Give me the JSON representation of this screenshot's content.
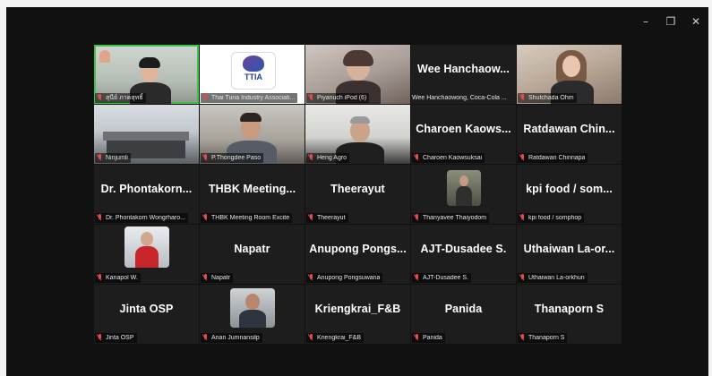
{
  "window": {
    "minimize_icon": "–",
    "restore_icon": "❐",
    "close_icon": "✕"
  },
  "participants": [
    {
      "id": "p0",
      "display_name": "",
      "tag": "สุนีย์ ภาคสุทธิ์",
      "video": true,
      "active": true
    },
    {
      "id": "p1",
      "display_name": "",
      "tag": "Thai Tuna Industry Associati...",
      "video": true,
      "logo_text": "TTIA"
    },
    {
      "id": "p2",
      "display_name": "",
      "tag": "Piyanuch iPod (6)",
      "video": true
    },
    {
      "id": "p3",
      "display_name": "Wee Hanchaow...",
      "tag": "Wee Hanchaowong, Coca-Cola ...",
      "video": false
    },
    {
      "id": "p4",
      "display_name": "",
      "tag": "Shutchada Ohm",
      "video": true
    },
    {
      "id": "p5",
      "display_name": "",
      "tag": "Ninjumli",
      "video": true
    },
    {
      "id": "p6",
      "display_name": "",
      "tag": "P.Thongdee Paso",
      "video": true
    },
    {
      "id": "p7",
      "display_name": "",
      "tag": "Heng Agro",
      "video": true
    },
    {
      "id": "p8",
      "display_name": "Charoen Kaows...",
      "tag": "Charoen Kaowsuksai",
      "video": false
    },
    {
      "id": "p9",
      "display_name": "Ratdawan Chin...",
      "tag": "Ratdawan Chinnapa",
      "video": false
    },
    {
      "id": "p10",
      "display_name": "Dr. Phontakorn...",
      "tag": "Dr. Phontakorn Wongrharo...",
      "video": false
    },
    {
      "id": "p11",
      "display_name": "THBK Meeting...",
      "tag": "THBK Meeting Room Excite",
      "video": false
    },
    {
      "id": "p12",
      "display_name": "Theerayut",
      "tag": "Theerayut",
      "video": false
    },
    {
      "id": "p13",
      "display_name": "",
      "tag": "Thanyavee Thaiyodom",
      "video": false,
      "avatar": true
    },
    {
      "id": "p14",
      "display_name": "kpi food / som...",
      "tag": "kpi food / somphop",
      "video": false
    },
    {
      "id": "p15",
      "display_name": "",
      "tag": "Kanapol W.",
      "video": false,
      "avatar": true
    },
    {
      "id": "p16",
      "display_name": "Napatr",
      "tag": "Napatr",
      "video": false
    },
    {
      "id": "p17",
      "display_name": "Anupong Pongs...",
      "tag": "Anupong Pongsuwana",
      "video": false
    },
    {
      "id": "p18",
      "display_name": "AJT-Dusadee S.",
      "tag": "AJT-Dusadee S.",
      "video": false
    },
    {
      "id": "p19",
      "display_name": "Uthaiwan La-or...",
      "tag": "Uthaiwan La-orkhun",
      "video": false
    },
    {
      "id": "p20",
      "display_name": "Jinta OSP",
      "tag": "Jinta OSP",
      "video": false
    },
    {
      "id": "p21",
      "display_name": "",
      "tag": "Anan Jumnansilp",
      "video": false,
      "avatar": true
    },
    {
      "id": "p22",
      "display_name": "Kriengkrai_F&B",
      "tag": "Kriengkrai_F&B",
      "video": false
    },
    {
      "id": "p23",
      "display_name": "Panida",
      "tag": "Panida",
      "video": false
    },
    {
      "id": "p24",
      "display_name": "Thanaporn S",
      "tag": "Thanaporn S",
      "video": false
    }
  ]
}
